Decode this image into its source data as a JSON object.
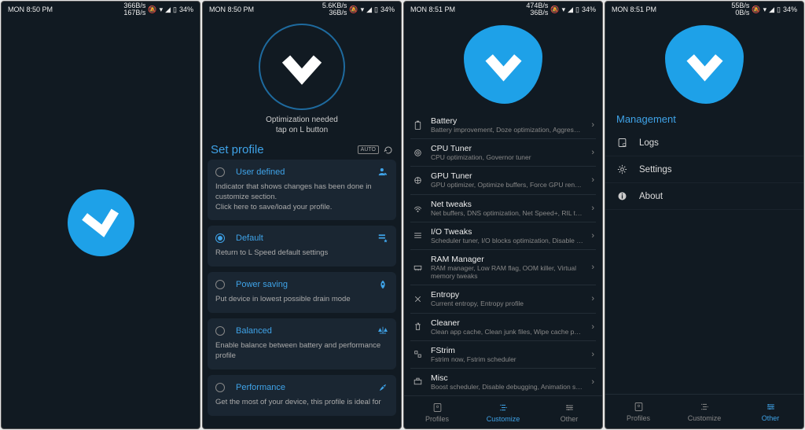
{
  "status": {
    "time1": "MON 8:50 PM",
    "time2": "MON 8:50 PM",
    "time3": "MON 8:51 PM",
    "time4": "MON 8:51 PM",
    "net1": "366B/s",
    "net1b": "167B/s",
    "net2": "5.6KB/s",
    "net2b": "36B/s",
    "net3": "474B/s",
    "net3b": "36B/s",
    "net4": "55B/s",
    "net4b": "0B/s",
    "battery": "34%"
  },
  "hero2": {
    "line1": "Optimization needed",
    "line2": "tap on L button"
  },
  "setProfile": {
    "title": "Set profile",
    "auto": "AUTO"
  },
  "profiles": [
    {
      "title": "User defined",
      "desc": "Indicator that shows changes has been done in customize section.\nClick here to save/load your profile.",
      "selected": false
    },
    {
      "title": "Default",
      "desc": "Return to L Speed default settings",
      "selected": true
    },
    {
      "title": "Power saving",
      "desc": "Put device in lowest possible drain mode",
      "selected": false
    },
    {
      "title": "Balanced",
      "desc": "Enable balance between battery and performance profile",
      "selected": false
    },
    {
      "title": "Performance",
      "desc": "Get the most of your device, this profile is ideal for",
      "selected": false
    }
  ],
  "features": [
    {
      "title": "Battery",
      "desc": "Battery improvement, Doze optimization, Aggressive doze"
    },
    {
      "title": "CPU Tuner",
      "desc": "CPU optimization, Governor tuner"
    },
    {
      "title": "GPU Tuner",
      "desc": "GPU optimizer, Optimize buffers, Force GPU rendering"
    },
    {
      "title": "Net tweaks",
      "desc": "Net buffers, DNS optimization, Net Speed+, RIL tweaks"
    },
    {
      "title": "I/O Tweaks",
      "desc": "Scheduler tuner, I/O blocks optimization, Disable I/O stats"
    },
    {
      "title": "RAM Manager",
      "desc": "RAM manager, Low RAM flag, OOM killer, Virtual memory tweaks"
    },
    {
      "title": "Entropy",
      "desc": "Current entropy, Entropy profile"
    },
    {
      "title": "Cleaner",
      "desc": "Clean app cache, Clean junk files, Wipe cache partition"
    },
    {
      "title": "FStrim",
      "desc": "Fstrim now, Fstrim scheduler"
    },
    {
      "title": "Misc",
      "desc": "Boost scheduler, Disable debugging, Animation scale, Selinux"
    }
  ],
  "mgmt": {
    "title": "Management",
    "items": [
      "Logs",
      "Settings",
      "About"
    ]
  },
  "nav": {
    "profiles": "Profiles",
    "customize": "Customize",
    "other": "Other"
  }
}
